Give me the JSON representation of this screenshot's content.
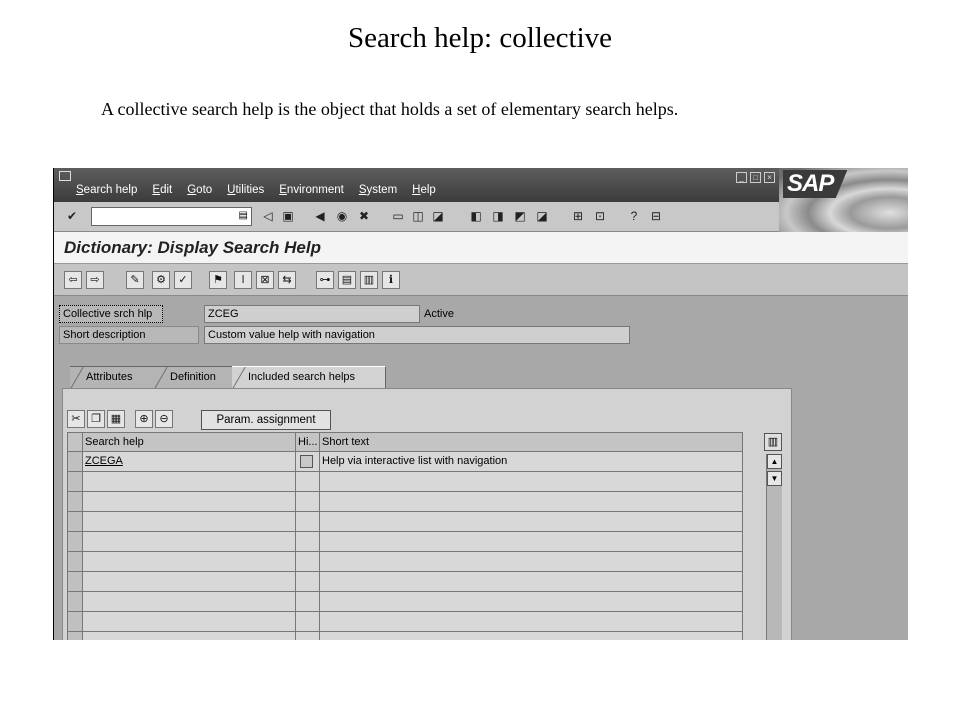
{
  "slide": {
    "title": "Search help: collective",
    "description": "A collective search help is the object that holds a set of elementary search helps."
  },
  "menu": [
    "Search help",
    "Edit",
    "Goto",
    "Utilities",
    "Environment",
    "System",
    "Help"
  ],
  "window_buttons": [
    "_",
    "□",
    "×"
  ],
  "logo": "SAP",
  "command_field": {
    "value": ""
  },
  "title": "Dictionary: Display Search Help",
  "fields": {
    "collective_label": "Collective srch hlp",
    "collective_value": "ZCEG",
    "status": "Active",
    "short_desc_label": "Short description",
    "short_desc_value": "Custom value help with navigation"
  },
  "tabs": [
    "Attributes",
    "Definition",
    "Included search helps"
  ],
  "param_button": "Param. assignment",
  "table": {
    "headers": [
      "Search help",
      "Hi...",
      "Short text"
    ],
    "rows": [
      {
        "search_help": "ZCEGA",
        "short_text": "Help via interactive list with navigation"
      }
    ]
  },
  "colors": {
    "menubar": "#4a4a4a",
    "workarea": "#a8a8a8",
    "title_bg": "#f4f4f4"
  }
}
